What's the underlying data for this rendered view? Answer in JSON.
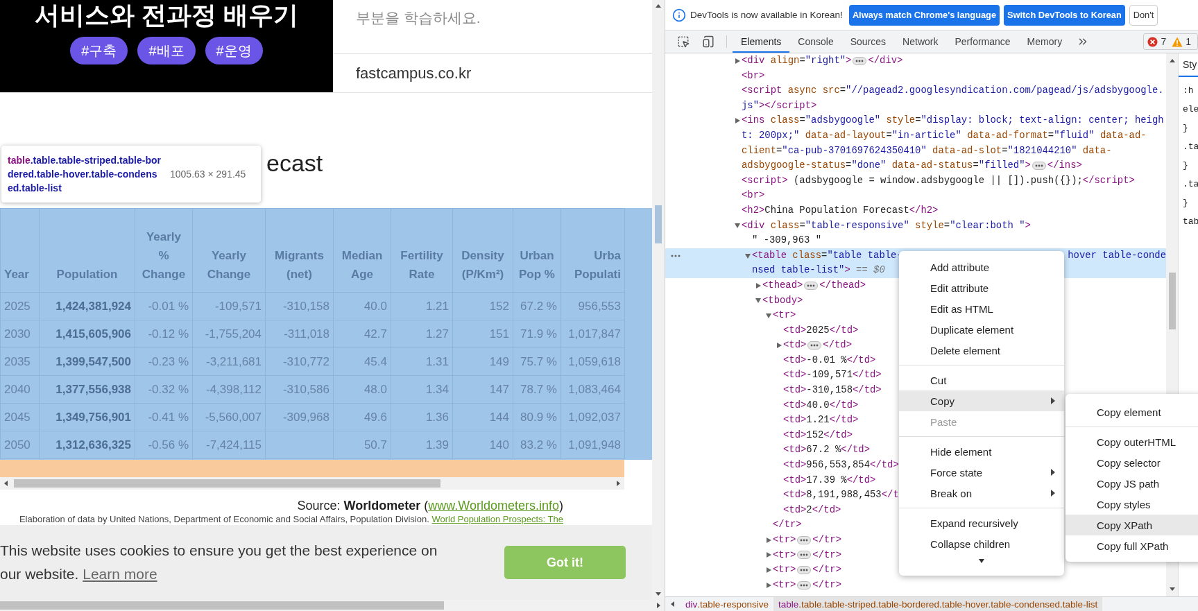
{
  "ad_banner": {
    "title": "서비스와 전과정 배우기",
    "tags": [
      "#구축",
      "#배포",
      "#운영"
    ],
    "description": "부분을 학습하세요.",
    "domain": "fastcampus.co.kr"
  },
  "inspector_tooltip": {
    "tag": "table",
    "classes": ".table.table-striped.table-bordered.table-hover.table-condensed.table-list",
    "size": "1005.63 × 291.45"
  },
  "heading": "ecast",
  "table": {
    "columns": [
      {
        "lines": [
          "Year"
        ],
        "bold": false
      },
      {
        "lines": [
          "Population"
        ],
        "bold": true
      },
      {
        "lines": [
          "Yearly",
          "%",
          "Change"
        ],
        "bold": false
      },
      {
        "lines": [
          "Yearly",
          "Change"
        ],
        "bold": false
      },
      {
        "lines": [
          "Migrants",
          "(net)"
        ],
        "bold": false
      },
      {
        "lines": [
          "Median",
          "Age"
        ],
        "bold": false
      },
      {
        "lines": [
          "Fertility",
          "Rate"
        ],
        "bold": false
      },
      {
        "lines": [
          "Density",
          "(P/Km²)"
        ],
        "bold": false
      },
      {
        "lines": [
          "Urban",
          "Pop %"
        ],
        "bold": false
      },
      {
        "lines": [
          "Urba",
          "Populati"
        ],
        "bold": false
      }
    ],
    "rows": [
      [
        "2025",
        "1,424,381,924",
        "-0.01 %",
        "-109,571",
        "-310,158",
        "40.0",
        "1.21",
        "152",
        "67.2 %",
        "956,553"
      ],
      [
        "2030",
        "1,415,605,906",
        "-0.12 %",
        "-1,755,204",
        "-311,018",
        "42.7",
        "1.27",
        "151",
        "71.9 %",
        "1,017,847"
      ],
      [
        "2035",
        "1,399,547,500",
        "-0.23 %",
        "-3,211,681",
        "-310,772",
        "45.4",
        "1.31",
        "149",
        "75.7 %",
        "1,059,618"
      ],
      [
        "2040",
        "1,377,556,938",
        "-0.32 %",
        "-4,398,112",
        "-310,586",
        "48.0",
        "1.34",
        "147",
        "78.7 %",
        "1,083,464"
      ],
      [
        "2045",
        "1,349,756,901",
        "-0.41 %",
        "-5,560,007",
        "-309,968",
        "49.6",
        "1.36",
        "144",
        "80.9 %",
        "1,092,037"
      ],
      [
        "2050",
        "1,312,636,325",
        "-0.56 %",
        "-7,424,115",
        null,
        "50.7",
        "1.39",
        "140",
        "83.2 %",
        "1,091,948"
      ]
    ]
  },
  "source": {
    "prefix": "Source: **Worldometer** (",
    "link": "www.Worldometers.info",
    "suffix": ")"
  },
  "elaboration": {
    "text": "Elaboration of data by United Nations, Department of Economic and Social Affairs, Population Division.",
    "link": "World Population Prospects: The"
  },
  "cookie_bar": {
    "message": "This website uses cookies to ensure you get the best experience on our website.",
    "link": "Learn more",
    "button": "Got it!"
  },
  "devtools": {
    "notice": {
      "text": "DevTools is now available in Korean!",
      "buttons": [
        {
          "label": "Always match Chrome's language",
          "kind": "primary"
        },
        {
          "label": "Switch DevTools to Korean",
          "kind": "primary"
        },
        {
          "label": "Don't",
          "kind": "secondary"
        }
      ]
    },
    "tabs": [
      {
        "label": "Elements",
        "selected": true
      },
      {
        "label": "Console",
        "selected": false
      },
      {
        "label": "Sources",
        "selected": false
      },
      {
        "label": "Network",
        "selected": false
      },
      {
        "label": "Performance",
        "selected": false
      },
      {
        "label": "Memory",
        "selected": false
      }
    ],
    "issues": {
      "errors": "7",
      "warnings": "1"
    },
    "dom_tree": [
      {
        "kind": "branch",
        "expanded": false,
        "selected": false,
        "lines": [
          "<div align=\"right\">"
        ],
        "close": "</div>"
      },
      {
        "kind": "leaf",
        "selected": false,
        "lines": [
          "<br>"
        ]
      },
      {
        "kind": "leaf",
        "selected": false,
        "lines": [
          "<script async src=\"//pagead2.googlesyndication.com/pagead/js/adsbygoogle.",
          "js\"></script>"
        ]
      },
      {
        "kind": "branch",
        "expanded": false,
        "selected": false,
        "lines": [
          "<ins class=\"adsbygoogle\" style=\"display: block; text-align: center; heigh",
          "t: 200px;\" data-ad-layout=\"in-article\" data-ad-format=\"fluid\" data-ad-",
          "client=\"ca-pub-3701697624350410\" data-ad-slot=\"1821044210\" data-",
          "adsbygoogle-status=\"done\" data-ad-status=\"filled\">"
        ],
        "close": "</ins>"
      },
      {
        "kind": "leaf",
        "selected": false,
        "lines": [
          "<script> (adsbygoogle = window.adsbygoogle || []).push({});</script>"
        ]
      },
      {
        "kind": "leaf",
        "selected": false,
        "lines": [
          "<br>"
        ]
      },
      {
        "kind": "leaf",
        "selected": false,
        "lines": [
          "<h2>China Population Forecast</h2>"
        ]
      },
      {
        "kind": "branch",
        "expanded": true,
        "selected": false,
        "lines": [
          "<div class=\"table-responsive\" style=\"clear:both \">"
        ],
        "children": [
          {
            "kind": "leaf",
            "selected": false,
            "lines": [
              "\" -309,963 \""
            ]
          },
          {
            "kind": "branch",
            "expanded": true,
            "selected": true,
            "lines": [
              "<table class=\"table table-",
              "nsed table-list\">"
            ],
            "covered_tail": "hover table-conde",
            "console_ref": "== $0",
            "children": [
              {
                "kind": "branch",
                "expanded": false,
                "selected": false,
                "lines": [
                  "<thead>"
                ],
                "close": "</thead>"
              },
              {
                "kind": "branch",
                "expanded": true,
                "selected": false,
                "lines": [
                  "<tbody>"
                ],
                "children": [
                  {
                    "kind": "branch",
                    "expanded": true,
                    "selected": false,
                    "lines": [
                      "<tr>"
                    ],
                    "close": "</tr>",
                    "children": [
                      {
                        "kind": "leaf",
                        "selected": false,
                        "lines": [
                          "<td>2025</td>"
                        ]
                      },
                      {
                        "kind": "branch",
                        "expanded": false,
                        "selected": false,
                        "lines": [
                          "<td>"
                        ],
                        "close": "</td>"
                      },
                      {
                        "kind": "leaf",
                        "selected": false,
                        "lines": [
                          "<td>-0.01 %</td>"
                        ]
                      },
                      {
                        "kind": "leaf",
                        "selected": false,
                        "lines": [
                          "<td>-109,571</td>"
                        ]
                      },
                      {
                        "kind": "leaf",
                        "selected": false,
                        "lines": [
                          "<td>-310,158</td>"
                        ]
                      },
                      {
                        "kind": "leaf",
                        "selected": false,
                        "lines": [
                          "<td>40.0</td>"
                        ]
                      },
                      {
                        "kind": "leaf",
                        "selected": false,
                        "lines": [
                          "<td>1.21</td>"
                        ]
                      },
                      {
                        "kind": "leaf",
                        "selected": false,
                        "lines": [
                          "<td>152</td>"
                        ]
                      },
                      {
                        "kind": "leaf",
                        "selected": false,
                        "lines": [
                          "<td>67.2 %</td>"
                        ]
                      },
                      {
                        "kind": "leaf",
                        "selected": false,
                        "lines": [
                          "<td>956,553,854</td>"
                        ]
                      },
                      {
                        "kind": "leaf",
                        "selected": false,
                        "lines": [
                          "<td>17.39 %</td>"
                        ]
                      },
                      {
                        "kind": "leaf",
                        "selected": false,
                        "lines": [
                          "<td>8,191,988,453</t"
                        ]
                      },
                      {
                        "kind": "leaf",
                        "selected": false,
                        "lines": [
                          "<td>2</td>"
                        ]
                      }
                    ]
                  },
                  {
                    "kind": "branch",
                    "expanded": false,
                    "selected": false,
                    "lines": [
                      "<tr>"
                    ],
                    "close": "</tr>"
                  },
                  {
                    "kind": "branch",
                    "expanded": false,
                    "selected": false,
                    "lines": [
                      "<tr>"
                    ],
                    "close": "</tr>"
                  },
                  {
                    "kind": "branch",
                    "expanded": false,
                    "selected": false,
                    "lines": [
                      "<tr>"
                    ],
                    "close": "</tr>"
                  },
                  {
                    "kind": "branch",
                    "expanded": false,
                    "selected": false,
                    "lines": [
                      "<tr>"
                    ],
                    "close": "</tr>"
                  }
                ]
              }
            ]
          }
        ]
      }
    ],
    "styles_fragments": [
      "Sty",
      ":h",
      "ele",
      "}",
      ".ta",
      "}",
      ".ta",
      "}",
      "tab"
    ],
    "context_menu": {
      "items": [
        {
          "kind": "item",
          "label": "Add attribute",
          "highlighted": false,
          "disabled": false,
          "has_submenu": false
        },
        {
          "kind": "item",
          "label": "Edit attribute",
          "highlighted": false,
          "disabled": false,
          "has_submenu": false
        },
        {
          "kind": "item",
          "label": "Edit as HTML",
          "highlighted": false,
          "disabled": false,
          "has_submenu": false
        },
        {
          "kind": "item",
          "label": "Duplicate element",
          "highlighted": false,
          "disabled": false,
          "has_submenu": false
        },
        {
          "kind": "item",
          "label": "Delete element",
          "highlighted": false,
          "disabled": false,
          "has_submenu": false
        },
        {
          "kind": "separator"
        },
        {
          "kind": "item",
          "label": "Cut",
          "highlighted": false,
          "disabled": false,
          "has_submenu": false
        },
        {
          "kind": "item",
          "label": "Copy",
          "highlighted": true,
          "disabled": false,
          "has_submenu": true,
          "submenu": {
            "items": [
              {
                "kind": "item",
                "label": "Copy element",
                "highlighted": false,
                "disabled": false,
                "has_submenu": false
              },
              {
                "kind": "separator"
              },
              {
                "kind": "item",
                "label": "Copy outerHTML",
                "highlighted": false,
                "disabled": false,
                "has_submenu": false
              },
              {
                "kind": "item",
                "label": "Copy selector",
                "highlighted": false,
                "disabled": false,
                "has_submenu": false
              },
              {
                "kind": "item",
                "label": "Copy JS path",
                "highlighted": false,
                "disabled": false,
                "has_submenu": false
              },
              {
                "kind": "item",
                "label": "Copy styles",
                "highlighted": false,
                "disabled": false,
                "has_submenu": false
              },
              {
                "kind": "item",
                "label": "Copy XPath",
                "highlighted": true,
                "disabled": false,
                "has_submenu": false
              },
              {
                "kind": "item",
                "label": "Copy full XPath",
                "highlighted": false,
                "disabled": false,
                "has_submenu": false
              }
            ]
          }
        },
        {
          "kind": "item",
          "label": "Paste",
          "highlighted": false,
          "disabled": true,
          "has_submenu": false
        },
        {
          "kind": "separator"
        },
        {
          "kind": "item",
          "label": "Hide element",
          "highlighted": false,
          "disabled": false,
          "has_submenu": false
        },
        {
          "kind": "item",
          "label": "Force state",
          "highlighted": false,
          "disabled": false,
          "has_submenu": true
        },
        {
          "kind": "item",
          "label": "Break on",
          "highlighted": false,
          "disabled": false,
          "has_submenu": true
        },
        {
          "kind": "separator"
        },
        {
          "kind": "item",
          "label": "Expand recursively",
          "highlighted": false,
          "disabled": false,
          "has_submenu": false
        },
        {
          "kind": "item",
          "label": "Collapse children",
          "highlighted": false,
          "disabled": false,
          "has_submenu": false
        }
      ]
    },
    "breadcrumbs": [
      {
        "tag": "div",
        "classes": ".table-responsive",
        "selected": false
      },
      {
        "tag": "table",
        "classes": ".table.table-striped.table-bordered.table-hover.table-condensed.table-list",
        "selected": true
      }
    ]
  }
}
